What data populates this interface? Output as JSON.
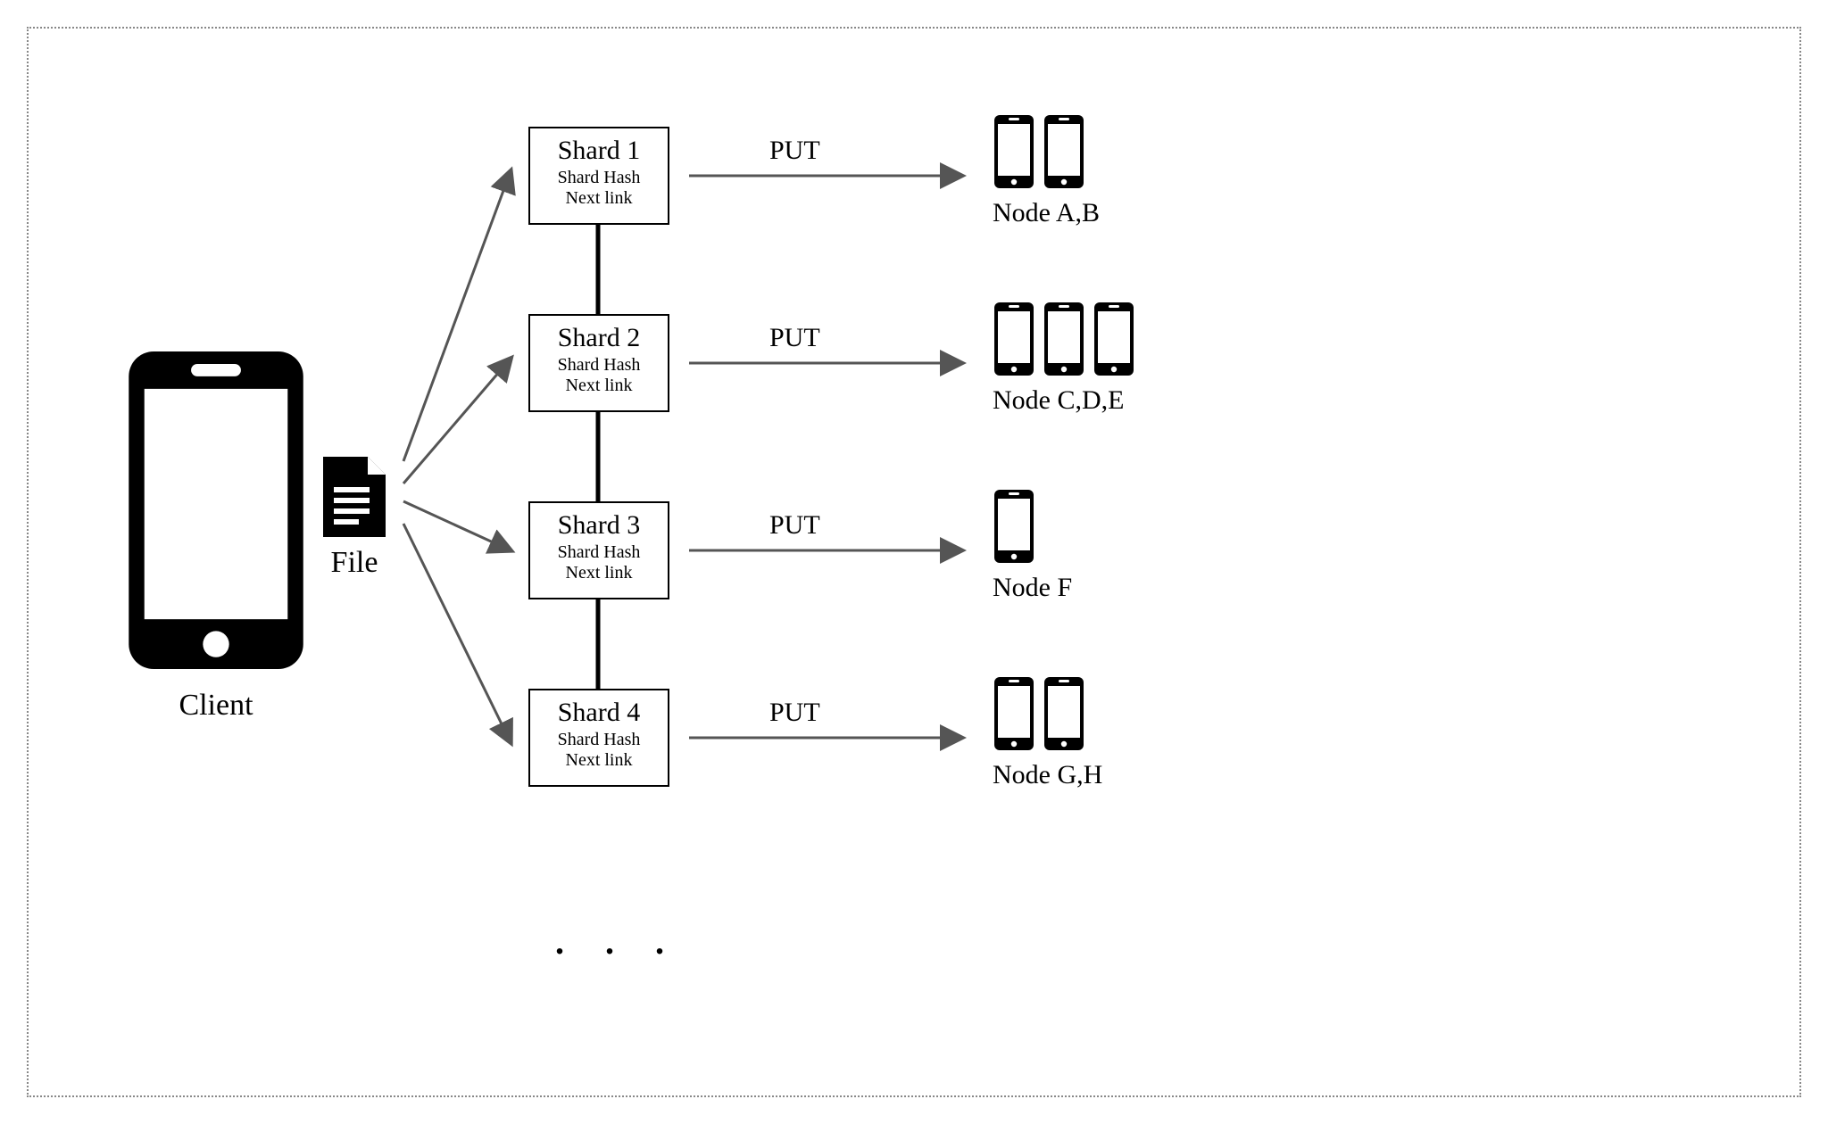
{
  "client": {
    "label": "Client"
  },
  "file": {
    "label": "File"
  },
  "shards": [
    {
      "title": "Shard 1",
      "line1": "Shard Hash",
      "line2": "Next link",
      "op": "PUT",
      "node_label": "Node A,B",
      "phone_count": 2
    },
    {
      "title": "Shard 2",
      "line1": "Shard Hash",
      "line2": "Next link",
      "op": "PUT",
      "node_label": "Node C,D,E",
      "phone_count": 3
    },
    {
      "title": "Shard 3",
      "line1": "Shard Hash",
      "line2": "Next link",
      "op": "PUT",
      "node_label": "Node F",
      "phone_count": 1
    },
    {
      "title": "Shard 4",
      "line1": "Shard Hash",
      "line2": "Next link",
      "op": "PUT",
      "node_label": "Node G,H",
      "phone_count": 2
    }
  ],
  "ellipsis": ". . ."
}
